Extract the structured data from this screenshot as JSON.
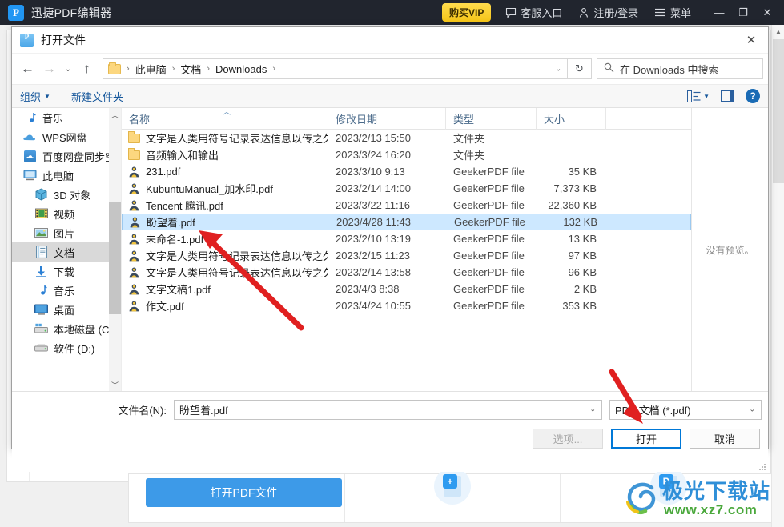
{
  "app": {
    "title": "迅捷PDF编辑器",
    "logo_glyph": "P",
    "vip_button": "购买VIP",
    "nav": [
      {
        "label": "客服入口",
        "icon": "chat-icon"
      },
      {
        "label": "注册/登录",
        "icon": "user-icon"
      },
      {
        "label": "菜单",
        "icon": "hamburger-icon"
      }
    ],
    "window_controls": {
      "minimize": "—",
      "maximize": "❐",
      "close": "✕"
    },
    "open_pdf_button": "打开PDF文件",
    "card_icons": [
      "plus-badge-icon",
      "pdf-badge-icon"
    ],
    "card_badges": [
      "+",
      "P"
    ],
    "watermark": {
      "title": "极光下载站",
      "url": "www.xz7.com"
    },
    "accent_color": "#3d9ae8",
    "titlebar_color": "#21252e",
    "vip_color": "#f5c518"
  },
  "dialog": {
    "icon": "pdf-app-icon",
    "title": "打开文件",
    "close_label": "✕",
    "nav": {
      "back": "←",
      "forward": "→",
      "recent": "⌄",
      "up": "↑",
      "refresh": "↻",
      "breadcrumb": [
        "此电脑",
        "文档",
        "Downloads"
      ],
      "breadcrumb_sep": "›",
      "search_placeholder": "在 Downloads 中搜索",
      "search_value": ""
    },
    "toolbar": {
      "organize": "组织",
      "new_folder": "新建文件夹",
      "view_icon": "list-view-icon",
      "pane_icon": "preview-pane-icon",
      "help_icon": "help-icon",
      "help_glyph": "?"
    },
    "tree": [
      {
        "label": "音乐",
        "icon": "music-note-icon",
        "indent": false,
        "selected": false
      },
      {
        "label": "WPS网盘",
        "icon": "cloud-icon",
        "indent": false,
        "selected": false
      },
      {
        "label": "百度网盘同步空间",
        "icon": "baidu-cloud-icon",
        "indent": false,
        "selected": false
      },
      {
        "label": "此电脑",
        "icon": "this-pc-icon",
        "indent": false,
        "selected": false
      },
      {
        "label": "3D 对象",
        "icon": "3d-objects-icon",
        "indent": true,
        "selected": false
      },
      {
        "label": "视频",
        "icon": "video-icon",
        "indent": true,
        "selected": false
      },
      {
        "label": "图片",
        "icon": "pictures-icon",
        "indent": true,
        "selected": false
      },
      {
        "label": "文档",
        "icon": "documents-icon",
        "indent": true,
        "selected": true
      },
      {
        "label": "下载",
        "icon": "downloads-icon",
        "indent": true,
        "selected": false
      },
      {
        "label": "音乐",
        "icon": "music-note-icon",
        "indent": true,
        "selected": false
      },
      {
        "label": "桌面",
        "icon": "desktop-icon",
        "indent": true,
        "selected": false
      },
      {
        "label": "本地磁盘 (C:)",
        "icon": "local-disk-icon",
        "indent": true,
        "selected": false
      },
      {
        "label": "软件 (D:)",
        "icon": "drive-icon",
        "indent": true,
        "selected": false
      }
    ],
    "columns": [
      "名称",
      "修改日期",
      "类型",
      "大小"
    ],
    "files": [
      {
        "name": "文字是人类用符号记录表达信息以传之久...",
        "date": "2023/2/13 15:50",
        "type": "文件夹",
        "size": "",
        "icon": "folder-icon",
        "selected": false
      },
      {
        "name": "音频输入和输出",
        "date": "2023/3/24 16:20",
        "type": "文件夹",
        "size": "",
        "icon": "folder-icon",
        "selected": false
      },
      {
        "name": "231.pdf",
        "date": "2023/3/10 9:13",
        "type": "GeekerPDF file",
        "size": "35 KB",
        "icon": "pdf-file-icon",
        "selected": false
      },
      {
        "name": "KubuntuManual_加水印.pdf",
        "date": "2023/2/14 14:00",
        "type": "GeekerPDF file",
        "size": "7,373 KB",
        "icon": "pdf-file-icon",
        "selected": false
      },
      {
        "name": "Tencent 腾讯.pdf",
        "date": "2023/3/22 11:16",
        "type": "GeekerPDF file",
        "size": "22,360 KB",
        "icon": "pdf-file-icon",
        "selected": false
      },
      {
        "name": "盼望着.pdf",
        "date": "2023/4/28 11:43",
        "type": "GeekerPDF file",
        "size": "132 KB",
        "icon": "pdf-file-icon",
        "selected": true
      },
      {
        "name": "未命名-1.pdf",
        "date": "2023/2/10 13:19",
        "type": "GeekerPDF file",
        "size": "13 KB",
        "icon": "pdf-file-icon",
        "selected": false
      },
      {
        "name": "文字是人类用符号记录表达信息以传之久...",
        "date": "2023/2/15 11:23",
        "type": "GeekerPDF file",
        "size": "97 KB",
        "icon": "pdf-file-icon",
        "selected": false
      },
      {
        "name": "文字是人类用符号记录表达信息以传之久...",
        "date": "2023/2/14 13:58",
        "type": "GeekerPDF file",
        "size": "96 KB",
        "icon": "pdf-file-icon",
        "selected": false
      },
      {
        "name": "文字文稿1.pdf",
        "date": "2023/4/3 8:38",
        "type": "GeekerPDF file",
        "size": "2 KB",
        "icon": "pdf-file-icon",
        "selected": false
      },
      {
        "name": "作文.pdf",
        "date": "2023/4/24 10:55",
        "type": "GeekerPDF file",
        "size": "353 KB",
        "icon": "pdf-file-icon",
        "selected": false
      }
    ],
    "preview": {
      "empty_text": "没有预览。"
    },
    "bottom": {
      "filename_label": "文件名(N):",
      "filename_value": "盼望着.pdf",
      "filetype_value": "PDF 文档 (*.pdf)",
      "options_button": "选项...",
      "open_button": "打开",
      "cancel_button": "取消",
      "primary_color": "#0078d7"
    }
  }
}
